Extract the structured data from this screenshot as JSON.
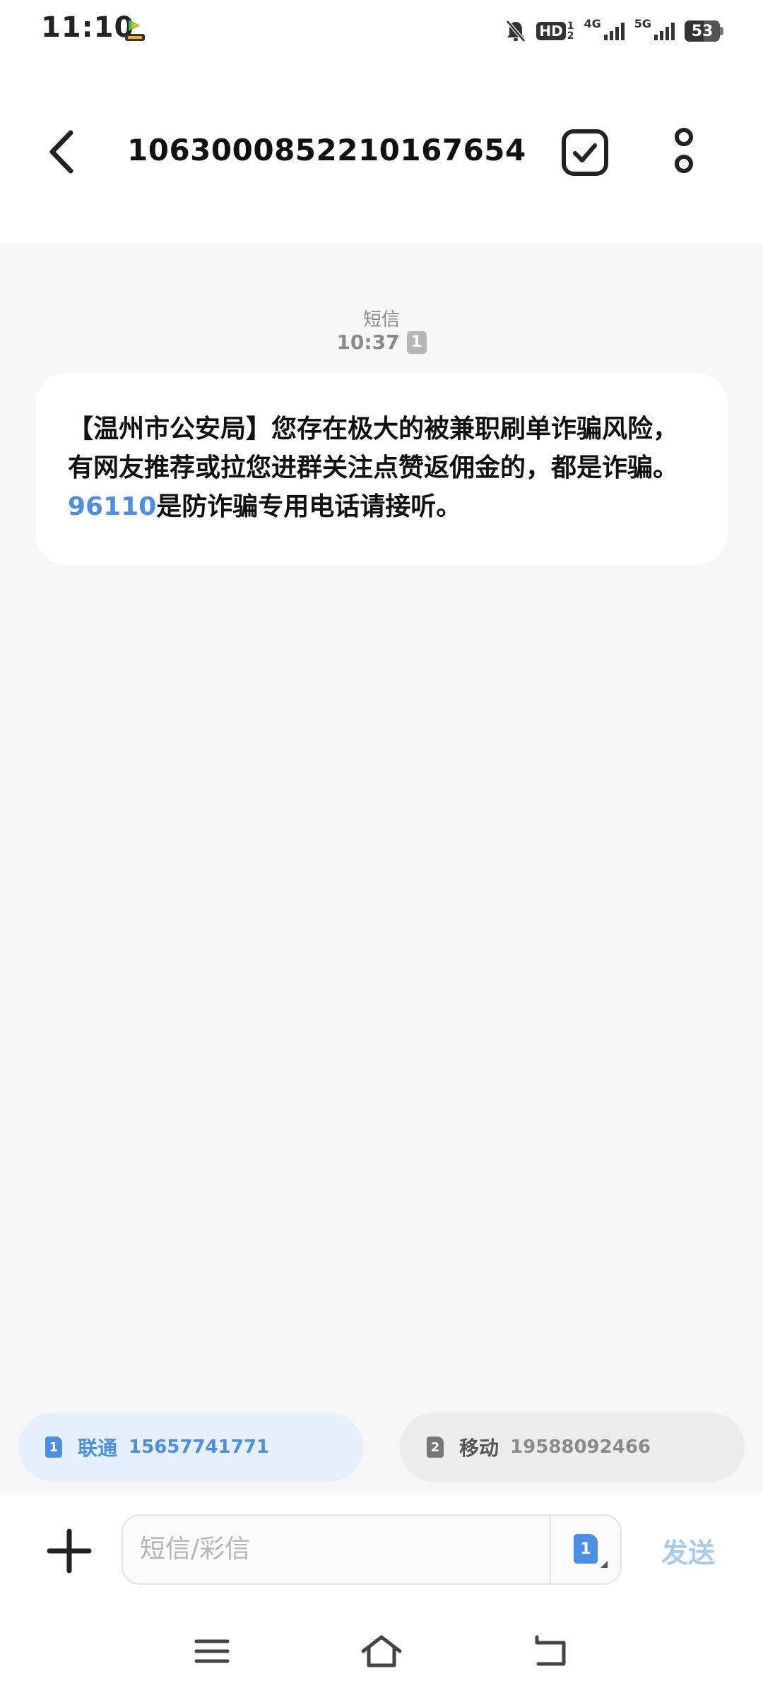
{
  "status_bar": {
    "time": "11:10",
    "hd_label": "HD",
    "hd_sub_top": "1",
    "hd_sub_bottom": "2",
    "net1_label": "4G",
    "net2_label": "5G",
    "battery_level": "53",
    "battery_fraction": 0.53
  },
  "header": {
    "sender": "1063000852210167654"
  },
  "conversation": {
    "message_type": "短信",
    "time": "10:37",
    "sim_badge": "1",
    "message": {
      "text_before": "【温州市公安局】您存在极大的被兼职刷单诈骗风险，有网友推荐或拉您进群关注点赞返佣金的，都是诈骗。",
      "link": "96110",
      "text_after": "是防诈骗专用电话请接听。"
    }
  },
  "sim_selector": {
    "sim1": {
      "index": "1",
      "carrier": "联通",
      "number": "15657741771",
      "selected": true
    },
    "sim2": {
      "index": "2",
      "carrier": "移动",
      "number": "19588092466",
      "selected": false
    }
  },
  "composer": {
    "placeholder": "短信/彩信",
    "sim_icon": "1",
    "send_label": "发送"
  },
  "colors": {
    "accent": "#4a8fe2",
    "send_disabled": "#a9c9ef",
    "background": "#f6f6f6"
  },
  "icons": {
    "back": "chevron-left-icon",
    "select": "checkbox-icon",
    "more": "more-vertical-icon",
    "add": "plus-icon",
    "nav_menu": "menu-icon",
    "nav_home": "home-icon",
    "nav_back": "back-icon"
  }
}
